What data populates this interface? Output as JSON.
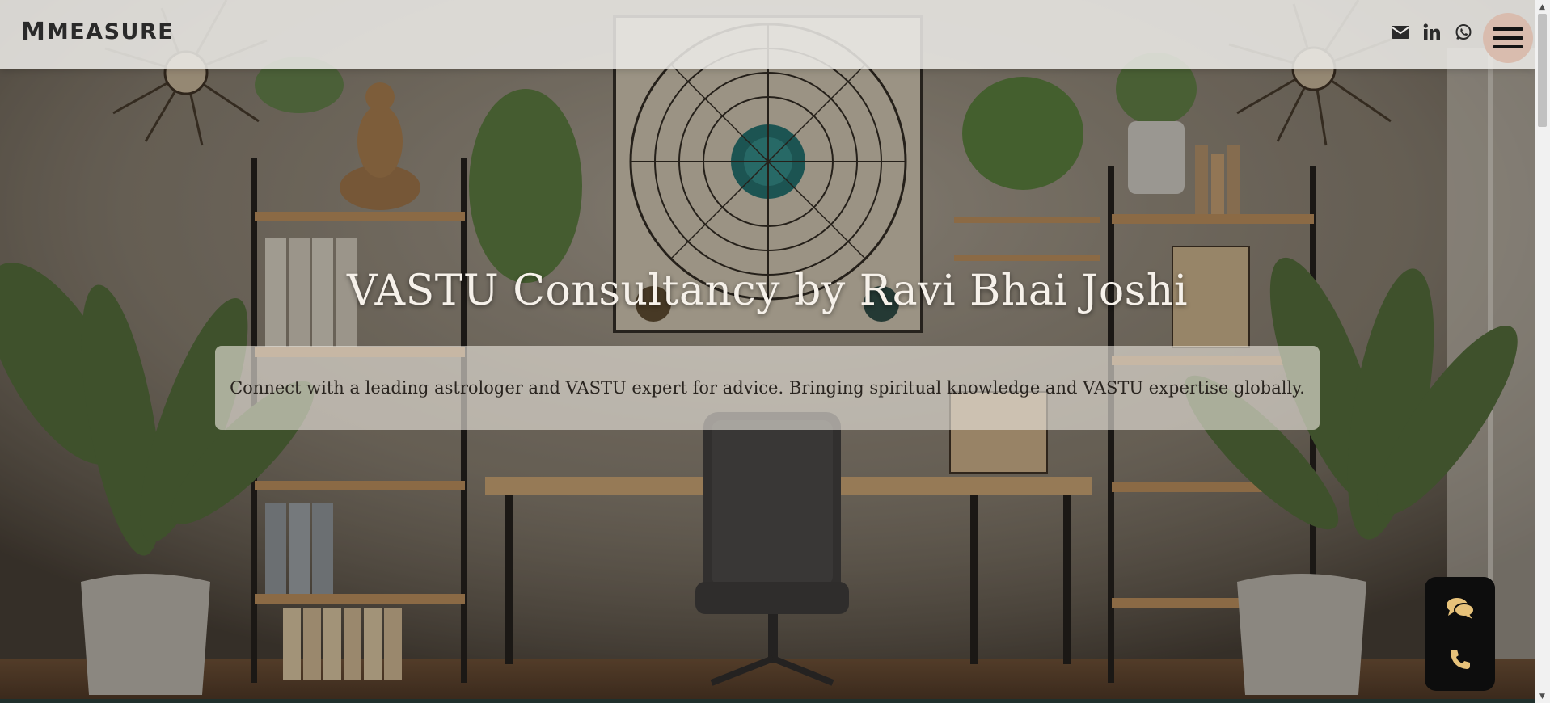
{
  "header": {
    "logo_mark": "M",
    "logo_text": "MEASURE",
    "icons": [
      "email-icon",
      "linkedin-icon",
      "whatsapp-icon"
    ],
    "menu_icon": "hamburger-menu-icon"
  },
  "hero": {
    "title": "VASTU Consultancy by Ravi Bhai Joshi",
    "subtitle": "Connect with a leading astrologer and VASTU expert for advice. Bringing spiritual knowledge and VASTU expertise globally.",
    "background_image": "astrology office interior with shelves, plants and zodiac chart"
  },
  "floating_widget": {
    "icons": [
      "chat-icon",
      "phone-icon"
    ],
    "icon_color": "#e7c27a"
  },
  "colors": {
    "header_bg": "#eeece9",
    "menu_button_bg": "#d9bcae",
    "widget_bg": "#0d0d0d",
    "title_text": "#f6f1ea"
  }
}
